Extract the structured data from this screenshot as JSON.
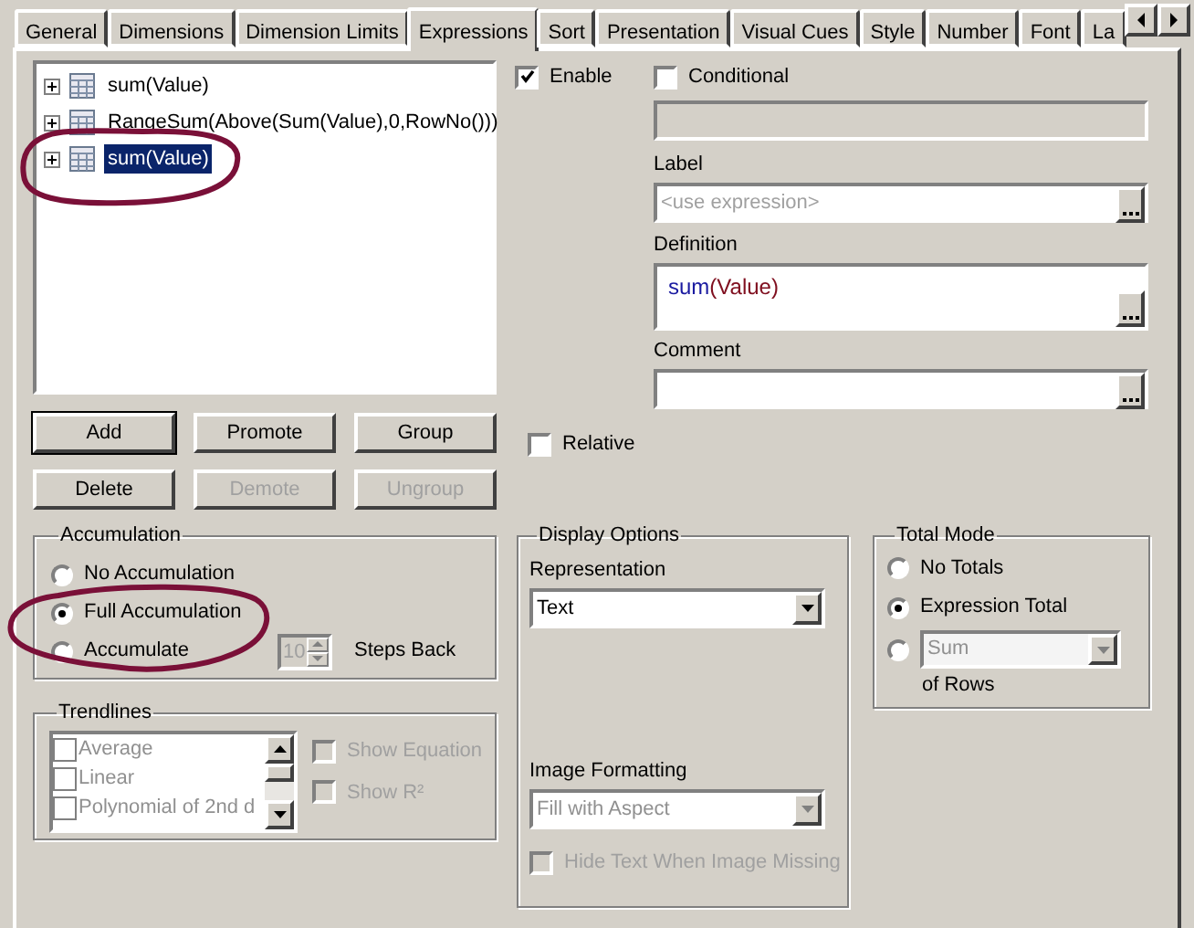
{
  "tabs": [
    {
      "label": "General",
      "selected": false
    },
    {
      "label": "Dimensions",
      "selected": false
    },
    {
      "label": "Dimension Limits",
      "selected": false
    },
    {
      "label": "Expressions",
      "selected": true
    },
    {
      "label": "Sort",
      "selected": false
    },
    {
      "label": "Presentation",
      "selected": false
    },
    {
      "label": "Visual Cues",
      "selected": false
    },
    {
      "label": "Style",
      "selected": false
    },
    {
      "label": "Number",
      "selected": false
    },
    {
      "label": "Font",
      "selected": false
    },
    {
      "label": "La",
      "selected": false
    }
  ],
  "expressions": [
    {
      "label": "sum(Value)",
      "selected": false,
      "expanded": false
    },
    {
      "label": "RangeSum(Above(Sum(Value),0,RowNo()))",
      "selected": false,
      "expanded": false
    },
    {
      "label": "sum(Value)",
      "selected": true,
      "expanded": false
    }
  ],
  "enable": {
    "label": "Enable",
    "checked": true
  },
  "conditional": {
    "label": "Conditional",
    "checked": false
  },
  "label_field": {
    "caption": "Label",
    "placeholder": "<use expression>"
  },
  "definition": {
    "caption": "Definition",
    "tokens": [
      {
        "text": "sum",
        "kind": "function"
      },
      {
        "text": "(Value)",
        "kind": "field"
      }
    ]
  },
  "comment": {
    "caption": "Comment"
  },
  "buttons": [
    {
      "label": "Add",
      "disabled": false,
      "default": true
    },
    {
      "label": "Promote",
      "disabled": false,
      "default": false
    },
    {
      "label": "Group",
      "disabled": false,
      "default": false
    },
    {
      "label": "Delete",
      "disabled": false,
      "default": false
    },
    {
      "label": "Demote",
      "disabled": true,
      "default": false
    },
    {
      "label": "Ungroup",
      "disabled": true,
      "default": false
    }
  ],
  "relative": {
    "label": "Relative",
    "checked": false
  },
  "accumulation": {
    "title": "Accumulation",
    "options": [
      {
        "label": "No Accumulation",
        "selected": false
      },
      {
        "label": "Full Accumulation",
        "selected": true
      },
      {
        "label": "Accumulate",
        "selected": false
      }
    ],
    "steps": "10",
    "steps_disabled": true,
    "steps_label": "Steps Back"
  },
  "trendlines": {
    "title": "Trendlines",
    "disabled": true,
    "items": [
      {
        "label": "Average",
        "checked": false
      },
      {
        "label": "Linear",
        "checked": false
      },
      {
        "label": "Polynomial of 2nd d",
        "checked": false
      }
    ],
    "options": [
      {
        "label": "Show Equation",
        "checked": false
      },
      {
        "label": "Show R²",
        "checked": false
      }
    ]
  },
  "display_options": {
    "title": "Display Options",
    "representation_label": "Representation",
    "representation": "Text",
    "image_formatting_label": "Image Formatting",
    "image_formatting": "Fill with Aspect",
    "image_formatting_disabled": true,
    "hide_text": {
      "label": "Hide Text When Image Missing",
      "checked": false,
      "disabled": true
    }
  },
  "total_mode": {
    "title": "Total Mode",
    "options": [
      {
        "kind": "label",
        "label": "No Totals",
        "selected": false
      },
      {
        "kind": "label",
        "label": "Expression Total",
        "selected": true
      },
      {
        "kind": "dropdown",
        "value": "Sum",
        "disabled": true,
        "selected": false
      }
    ],
    "suffix": "of Rows"
  },
  "annotations": [
    {
      "kind": "ellipse"
    },
    {
      "kind": "ellipse"
    }
  ]
}
